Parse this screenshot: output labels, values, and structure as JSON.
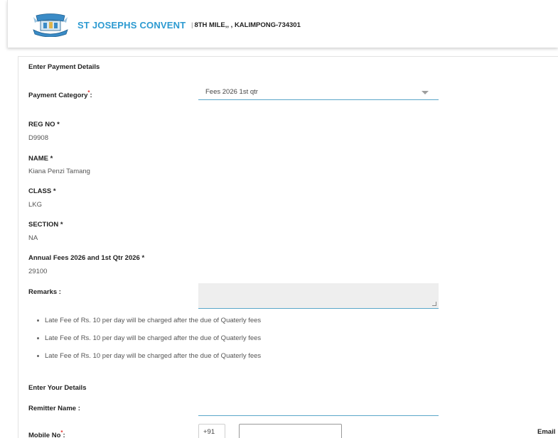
{
  "header": {
    "school_name": "ST JOSEPHS CONVENT",
    "separator": "|",
    "address": "8TH MILE,, , KALIMPONG-734301"
  },
  "payment": {
    "section_title": "Enter Payment Details",
    "category_label": "Payment Category",
    "category_colon": ":",
    "category_value": "Fees 2026 1st qtr",
    "required_mark": "*"
  },
  "fields": [
    {
      "label": "REG NO *",
      "value": "D9908"
    },
    {
      "label": "NAME *",
      "value": "Kiana Penzi Tamang"
    },
    {
      "label": "CLASS *",
      "value": "LKG"
    },
    {
      "label": "SECTION *",
      "value": "NA"
    },
    {
      "label": "Annual Fees 2026 and 1st Qtr 2026 *",
      "value": "29100"
    }
  ],
  "remarks": {
    "label": "Remarks :",
    "value": ""
  },
  "notes": [
    "Late Fee of Rs. 10 per day will be charged after the due of Quaterly fees",
    "Late Fee of Rs. 10 per day will be charged after the due of Quaterly fees",
    "Late Fee of Rs. 10 per day will be charged after the due of Quaterly fees"
  ],
  "details": {
    "section_title": "Enter Your Details",
    "remitter_label": "Remitter Name :",
    "remitter_value": "",
    "mobile_label": "Mobile No",
    "mobile_colon": ":",
    "mobile_prefix": "+91",
    "mobile_value": "",
    "email_label": "Email"
  },
  "colors": {
    "brand": "#2c9ad1",
    "underline": "#5aa6c9",
    "required": "#e53935"
  }
}
